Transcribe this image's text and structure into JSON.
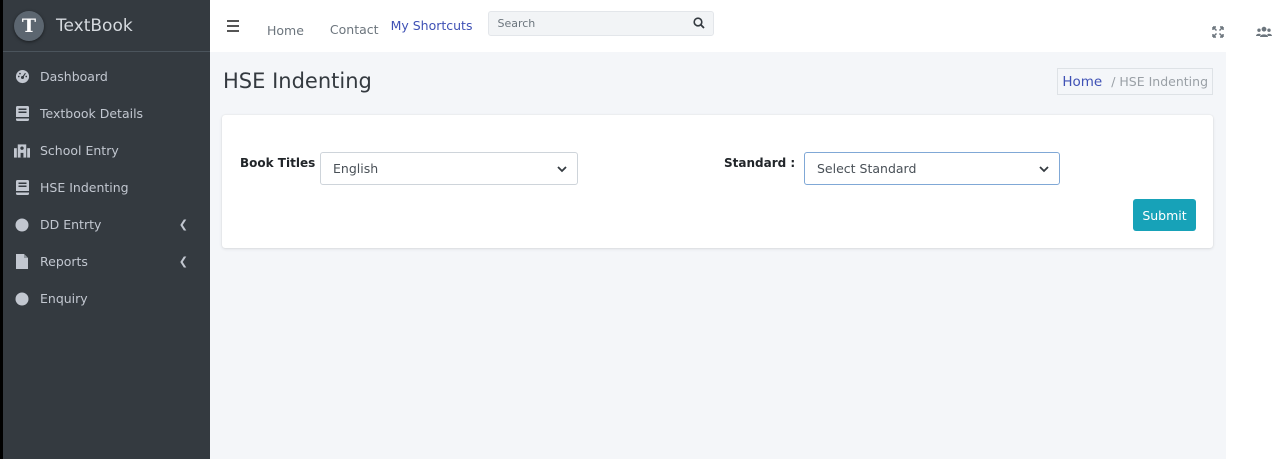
{
  "brand": {
    "logo_letter": "T",
    "name": "TextBook"
  },
  "sidebar": {
    "items": [
      {
        "label": "Dashboard",
        "icon": "tachometer-icon"
      },
      {
        "label": "Textbook Details",
        "icon": "book-icon"
      },
      {
        "label": "School Entry",
        "icon": "school-icon"
      },
      {
        "label": "HSE Indenting",
        "icon": "book-icon"
      },
      {
        "label": "DD Entrty",
        "icon": "circle-icon",
        "expandable": true
      },
      {
        "label": "Reports",
        "icon": "file-icon",
        "expandable": true
      },
      {
        "label": "Enquiry",
        "icon": "circle-icon"
      }
    ]
  },
  "topbar": {
    "links": {
      "home": "Home",
      "contact": "Contact",
      "shortcuts": "My Shortcuts"
    },
    "search": {
      "placeholder": "Search",
      "value": ""
    }
  },
  "page": {
    "title": "HSE Indenting",
    "breadcrumb": {
      "home": "Home",
      "separator": "/",
      "current": "HSE Indenting"
    }
  },
  "form": {
    "book_titles_label": "Book Titles :",
    "book_titles_value": "English",
    "standard_label": "Standard :",
    "standard_value": "Select Standard",
    "submit_label": "Submit"
  },
  "colors": {
    "sidebar_bg": "#343a40",
    "content_bg": "#f4f6f9",
    "accent_link": "#3f51b5",
    "submit_button": "#17a2b8"
  }
}
